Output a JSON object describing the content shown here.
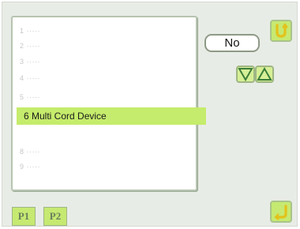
{
  "list": {
    "items": [
      {
        "label": "1 ·····"
      },
      {
        "label": "2 ·····"
      },
      {
        "label": "3 ·····"
      },
      {
        "label": "4 ·····"
      },
      {
        "label": "5 ·····"
      },
      {
        "label": "6 Multi Cord Device",
        "selected": true
      },
      {
        "label": "8 ·····"
      },
      {
        "label": "9 ·····"
      }
    ]
  },
  "controls": {
    "value_button": "No",
    "back_icon": "back-arrow-icon",
    "down_icon": "triangle-down-icon",
    "up_icon": "triangle-up-icon",
    "enter_icon": "enter-return-icon"
  },
  "pages": {
    "tabs": [
      {
        "label": "P1"
      },
      {
        "label": "P2"
      }
    ]
  },
  "colors": {
    "accent": "#c5ec6c",
    "panel_bg": "#e8ece6",
    "icon_green": "#3c7d3a"
  }
}
